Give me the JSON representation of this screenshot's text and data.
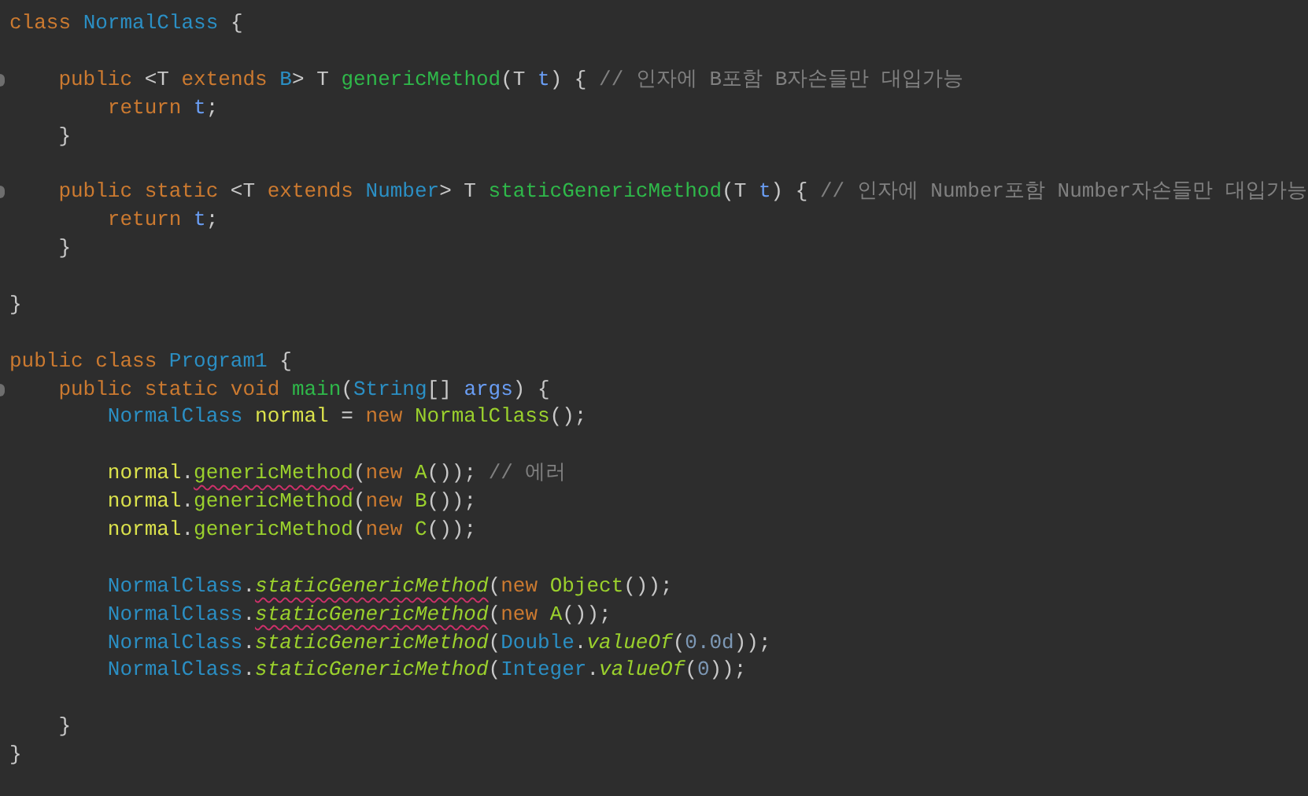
{
  "editor": {
    "lines": [
      {
        "fold": false,
        "tokens": [
          {
            "kind": "kw",
            "text": "class "
          },
          {
            "kind": "type",
            "text": "NormalClass"
          },
          {
            "kind": "plain",
            "text": " {"
          }
        ]
      },
      {
        "fold": false
      },
      {
        "fold": true,
        "tokens": [
          {
            "kind": "kw",
            "text": "    public"
          },
          {
            "kind": "plain",
            "text": " <T "
          },
          {
            "kind": "kw",
            "text": "extends "
          },
          {
            "kind": "type",
            "text": "B"
          },
          {
            "kind": "plain",
            "text": "> T "
          },
          {
            "kind": "decl",
            "text": "genericMethod"
          },
          {
            "kind": "plain",
            "text": "(T "
          },
          {
            "kind": "param",
            "text": "t"
          },
          {
            "kind": "plain",
            "text": ") { "
          },
          {
            "kind": "comment",
            "text": "// 인자에 B포함 B자손들만 대입가능"
          }
        ]
      },
      {
        "fold": false,
        "tokens": [
          {
            "kind": "kw",
            "text": "        return "
          },
          {
            "kind": "param",
            "text": "t"
          },
          {
            "kind": "plain",
            "text": ";"
          }
        ]
      },
      {
        "fold": false,
        "tokens": [
          {
            "kind": "plain",
            "text": "    }"
          }
        ]
      },
      {
        "fold": false
      },
      {
        "fold": true,
        "tokens": [
          {
            "kind": "kw",
            "text": "    public static"
          },
          {
            "kind": "plain",
            "text": " <T "
          },
          {
            "kind": "kw",
            "text": "extends "
          },
          {
            "kind": "type",
            "text": "Number"
          },
          {
            "kind": "plain",
            "text": "> T "
          },
          {
            "kind": "decl",
            "text": "staticGenericMethod"
          },
          {
            "kind": "plain",
            "text": "(T "
          },
          {
            "kind": "param",
            "text": "t"
          },
          {
            "kind": "plain",
            "text": ") { "
          },
          {
            "kind": "comment",
            "text": "// 인자에 Number포함 Number자손들만 대입가능"
          }
        ]
      },
      {
        "fold": false,
        "tokens": [
          {
            "kind": "kw",
            "text": "        return "
          },
          {
            "kind": "param",
            "text": "t"
          },
          {
            "kind": "plain",
            "text": ";"
          }
        ]
      },
      {
        "fold": false,
        "tokens": [
          {
            "kind": "plain",
            "text": "    }"
          }
        ]
      },
      {
        "fold": false
      },
      {
        "fold": false,
        "tokens": [
          {
            "kind": "plain",
            "text": "}"
          }
        ]
      },
      {
        "fold": false
      },
      {
        "fold": false,
        "tokens": [
          {
            "kind": "kw",
            "text": "public class "
          },
          {
            "kind": "type",
            "text": "Program1"
          },
          {
            "kind": "plain",
            "text": " {"
          }
        ]
      },
      {
        "fold": true,
        "tokens": [
          {
            "kind": "kw",
            "text": "    public static void "
          },
          {
            "kind": "decl",
            "text": "main"
          },
          {
            "kind": "plain",
            "text": "("
          },
          {
            "kind": "type",
            "text": "String"
          },
          {
            "kind": "plain",
            "text": "[] "
          },
          {
            "kind": "param",
            "text": "args"
          },
          {
            "kind": "plain",
            "text": ") {"
          }
        ]
      },
      {
        "fold": false,
        "tokens": [
          {
            "kind": "type",
            "text": "        NormalClass "
          },
          {
            "kind": "var",
            "text": "normal"
          },
          {
            "kind": "plain",
            "text": " = "
          },
          {
            "kind": "kw",
            "text": "new "
          },
          {
            "kind": "call",
            "text": "NormalClass"
          },
          {
            "kind": "plain",
            "text": "();"
          }
        ]
      },
      {
        "fold": false
      },
      {
        "fold": false,
        "tokens": [
          {
            "kind": "var",
            "text": "        normal"
          },
          {
            "kind": "plain",
            "text": "."
          },
          {
            "kind": "call",
            "text": "genericMethod",
            "error": true
          },
          {
            "kind": "plain",
            "text": "("
          },
          {
            "kind": "kw",
            "text": "new "
          },
          {
            "kind": "call",
            "text": "A"
          },
          {
            "kind": "plain",
            "text": "()); "
          },
          {
            "kind": "comment",
            "text": "// 에러"
          }
        ]
      },
      {
        "fold": false,
        "tokens": [
          {
            "kind": "var",
            "text": "        normal"
          },
          {
            "kind": "plain",
            "text": "."
          },
          {
            "kind": "call",
            "text": "genericMethod",
            "error": false
          },
          {
            "kind": "plain",
            "text": "("
          },
          {
            "kind": "kw",
            "text": "new "
          },
          {
            "kind": "call",
            "text": "B"
          },
          {
            "kind": "plain",
            "text": "());"
          }
        ]
      },
      {
        "fold": false,
        "tokens": [
          {
            "kind": "var",
            "text": "        normal"
          },
          {
            "kind": "plain",
            "text": "."
          },
          {
            "kind": "call",
            "text": "genericMethod",
            "error": false
          },
          {
            "kind": "plain",
            "text": "("
          },
          {
            "kind": "kw",
            "text": "new "
          },
          {
            "kind": "call",
            "text": "C"
          },
          {
            "kind": "plain",
            "text": "());"
          }
        ]
      },
      {
        "fold": false
      },
      {
        "fold": false,
        "tokens": [
          {
            "kind": "type",
            "text": "        NormalClass"
          },
          {
            "kind": "plain",
            "text": "."
          },
          {
            "kind": "scall",
            "text": "staticGenericMethod",
            "error": true
          },
          {
            "kind": "plain",
            "text": "("
          },
          {
            "kind": "kw",
            "text": "new "
          },
          {
            "kind": "call",
            "text": "Object"
          },
          {
            "kind": "plain",
            "text": "());"
          }
        ]
      },
      {
        "fold": false,
        "tokens": [
          {
            "kind": "type",
            "text": "        NormalClass"
          },
          {
            "kind": "plain",
            "text": "."
          },
          {
            "kind": "scall",
            "text": "staticGenericMethod",
            "error": true
          },
          {
            "kind": "plain",
            "text": "("
          },
          {
            "kind": "kw",
            "text": "new "
          },
          {
            "kind": "call",
            "text": "A"
          },
          {
            "kind": "plain",
            "text": "());"
          }
        ]
      },
      {
        "fold": false,
        "tokens": [
          {
            "kind": "type",
            "text": "        NormalClass"
          },
          {
            "kind": "plain",
            "text": "."
          },
          {
            "kind": "scall",
            "text": "staticGenericMethod",
            "error": false
          },
          {
            "kind": "plain",
            "text": "("
          },
          {
            "kind": "type",
            "text": "Double"
          },
          {
            "kind": "plain",
            "text": "."
          },
          {
            "kind": "scall",
            "text": "valueOf",
            "error": false
          },
          {
            "kind": "plain",
            "text": "("
          },
          {
            "kind": "num",
            "text": "0.0d"
          },
          {
            "kind": "plain",
            "text": "));"
          }
        ]
      },
      {
        "fold": false,
        "tokens": [
          {
            "kind": "type",
            "text": "        NormalClass"
          },
          {
            "kind": "plain",
            "text": "."
          },
          {
            "kind": "scall",
            "text": "staticGenericMethod",
            "error": false
          },
          {
            "kind": "plain",
            "text": "("
          },
          {
            "kind": "type",
            "text": "Integer"
          },
          {
            "kind": "plain",
            "text": "."
          },
          {
            "kind": "scall",
            "text": "valueOf",
            "error": false
          },
          {
            "kind": "plain",
            "text": "("
          },
          {
            "kind": "num",
            "text": "0"
          },
          {
            "kind": "plain",
            "text": "));"
          }
        ]
      },
      {
        "fold": false
      },
      {
        "fold": false,
        "tokens": [
          {
            "kind": "plain",
            "text": "    }"
          }
        ]
      },
      {
        "fold": false,
        "tokens": [
          {
            "kind": "plain",
            "text": "}"
          }
        ]
      }
    ]
  }
}
